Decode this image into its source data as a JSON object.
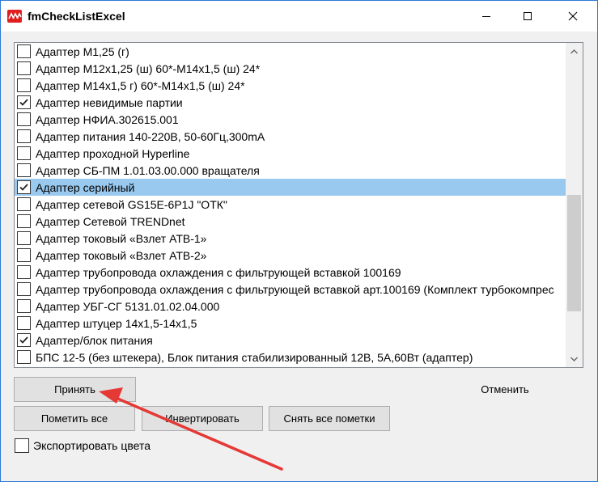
{
  "window": {
    "title": "fmCheckListExcel",
    "controls": {
      "minimize_icon": "minimize-icon",
      "maximize_icon": "maximize-icon",
      "close_icon": "close-icon"
    },
    "accent_color": "#2b79d6",
    "selection_color": "#99c9ef",
    "annotation_color": "#e53935"
  },
  "list": {
    "items": [
      {
        "label": "Адаптер М1,25 (г)",
        "checked": false,
        "selected": false
      },
      {
        "label": "Адаптер М12х1,25 (ш) 60*-М14х1,5 (ш) 24*",
        "checked": false,
        "selected": false
      },
      {
        "label": "Адаптер М14х1,5 г) 60*-М14х1,5 (ш) 24*",
        "checked": false,
        "selected": false
      },
      {
        "label": "Адаптер невидимые партии",
        "checked": true,
        "selected": false
      },
      {
        "label": "Адаптер НФИА.302615.001",
        "checked": false,
        "selected": false
      },
      {
        "label": "Адаптер питания 140-220В, 50-60Гц,300mA",
        "checked": false,
        "selected": false
      },
      {
        "label": "Адаптер проходной Hyperline",
        "checked": false,
        "selected": false
      },
      {
        "label": "Адаптер СБ-ПМ 1.01.03.00.000  вращателя",
        "checked": false,
        "selected": false
      },
      {
        "label": "Адаптер серийный",
        "checked": true,
        "selected": true
      },
      {
        "label": "Адаптер сетевой GS15E-6P1J \"ОТК\"",
        "checked": false,
        "selected": false
      },
      {
        "label": "Адаптер Сетевой TRENDnet",
        "checked": false,
        "selected": false
      },
      {
        "label": "Адаптер токовый «Взлет АТВ-1»",
        "checked": false,
        "selected": false
      },
      {
        "label": "Адаптер токовый «Взлет АТВ-2»",
        "checked": false,
        "selected": false
      },
      {
        "label": "Адаптер трубопровода охлаждения с фильтрующей вставкой 100169",
        "checked": false,
        "selected": false
      },
      {
        "label": "Адаптер трубопровода охлаждения с фильтрующей вставкой арт.100169 (Комплект турбокомпрес",
        "checked": false,
        "selected": false
      },
      {
        "label": "Адаптер УБГ-СГ 5131.01.02.04.000",
        "checked": false,
        "selected": false
      },
      {
        "label": "Адаптер штуцер 14х1,5-14х1,5",
        "checked": false,
        "selected": false
      },
      {
        "label": "Адаптер/блок питания",
        "checked": true,
        "selected": false
      },
      {
        "label": "БПС 12-5 (без штекера), Блок питания стабилизированный 12В, 5А,60Вт (адаптер)",
        "checked": false,
        "selected": false
      }
    ]
  },
  "buttons": {
    "accept": "Принять",
    "cancel": "Отменить",
    "mark_all": "Пометить все",
    "invert": "Инвертировать",
    "unmark_all": "Снять все пометки"
  },
  "export": {
    "label": "Экспортировать цвета",
    "checked": false
  }
}
